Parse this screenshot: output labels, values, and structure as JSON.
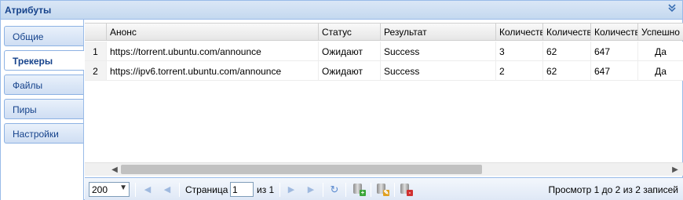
{
  "panel": {
    "title": "Атрибуты",
    "collapse_icon": "double-chevron-down-icon"
  },
  "tabs": [
    {
      "label": "Общие",
      "active": false
    },
    {
      "label": "Трекеры",
      "active": true
    },
    {
      "label": "Файлы",
      "active": false
    },
    {
      "label": "Пиры",
      "active": false
    },
    {
      "label": "Настройки",
      "active": false
    }
  ],
  "grid": {
    "columns": [
      "",
      "Анонс",
      "Статус",
      "Результат",
      "Количестве",
      "Количестве",
      "Количестве",
      "Успешно"
    ],
    "rows": [
      [
        "1",
        "https://torrent.ubuntu.com/announce",
        "Ожидают",
        "Success",
        "3",
        "62",
        "647",
        "Да"
      ],
      [
        "2",
        "https://ipv6.torrent.ubuntu.com/announce",
        "Ожидают",
        "Success",
        "2",
        "62",
        "647",
        "Да"
      ]
    ]
  },
  "pager": {
    "page_size": "200",
    "page_label": "Страница",
    "page_value": "1",
    "of_label": "из 1",
    "summary": "Просмотр 1 до 2 из 2 записей"
  },
  "colors": {
    "accent": "#15428b",
    "border": "#99bbe8"
  }
}
